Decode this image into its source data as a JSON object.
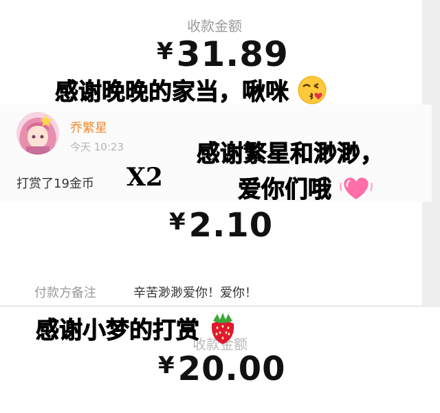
{
  "panel1": {
    "label": "收款金额",
    "amount_symbol": "¥",
    "amount": "31.89",
    "caption": "感谢晚晚的家当，啾咪"
  },
  "panel2": {
    "username": "乔繁星",
    "time": "今天 10:23",
    "reward_text": "打赏了19金币",
    "multiplier": "X2",
    "caption_line1": "感谢繁星和渺渺，",
    "caption_line2": "爱你们哦"
  },
  "panel3": {
    "amount_symbol": "¥",
    "amount": "2.10",
    "remark_label": "付款方备注",
    "remark_value": "辛苦渺渺爱你！爱你！"
  },
  "panel4": {
    "caption": "感谢小梦的打赏",
    "label": "收款金额",
    "amount_symbol": "¥",
    "amount": "20.00"
  },
  "icons": {
    "kiss_emoji": "face-blowing-kiss-icon",
    "heart_emoji": "growing-heart-icon",
    "strawberry_emoji": "strawberry-icon"
  },
  "colors": {
    "username": "#f08a2a",
    "label_gray": "#9b9b9b",
    "heart_pink": "#ff5fa2",
    "strawberry_red": "#e0182f"
  }
}
